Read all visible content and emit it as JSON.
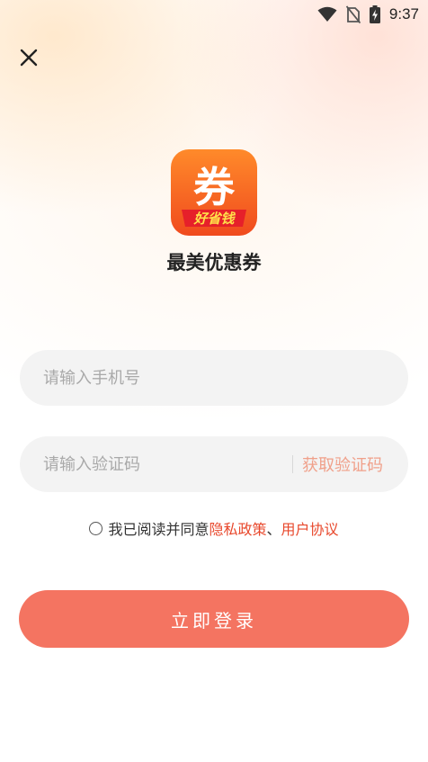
{
  "status_bar": {
    "time": "9:37",
    "icons": [
      "wifi-icon",
      "no-sim-icon",
      "battery-charging-icon"
    ]
  },
  "header": {
    "close_icon": "close-icon"
  },
  "logo": {
    "glyph": "券",
    "subtitle": "好省钱",
    "colors": {
      "top": "#ff8a2a",
      "bottom": "#f04a1e",
      "banner": "#e6202a"
    }
  },
  "app_name": "最美优惠券",
  "form": {
    "phone_placeholder": "请输入手机号",
    "code_placeholder": "请输入验证码",
    "get_code_label": "获取验证码"
  },
  "agreement": {
    "prefix": "我已阅读并同意",
    "privacy_link": "隐私政策",
    "separator": "、",
    "terms_link": "用户协议",
    "checked": false
  },
  "login_button": "立即登录",
  "colors": {
    "accent": "#f47461",
    "link": "#e8482c",
    "get_code": "#f0a08a",
    "field_bg": "#f3f3f3"
  }
}
